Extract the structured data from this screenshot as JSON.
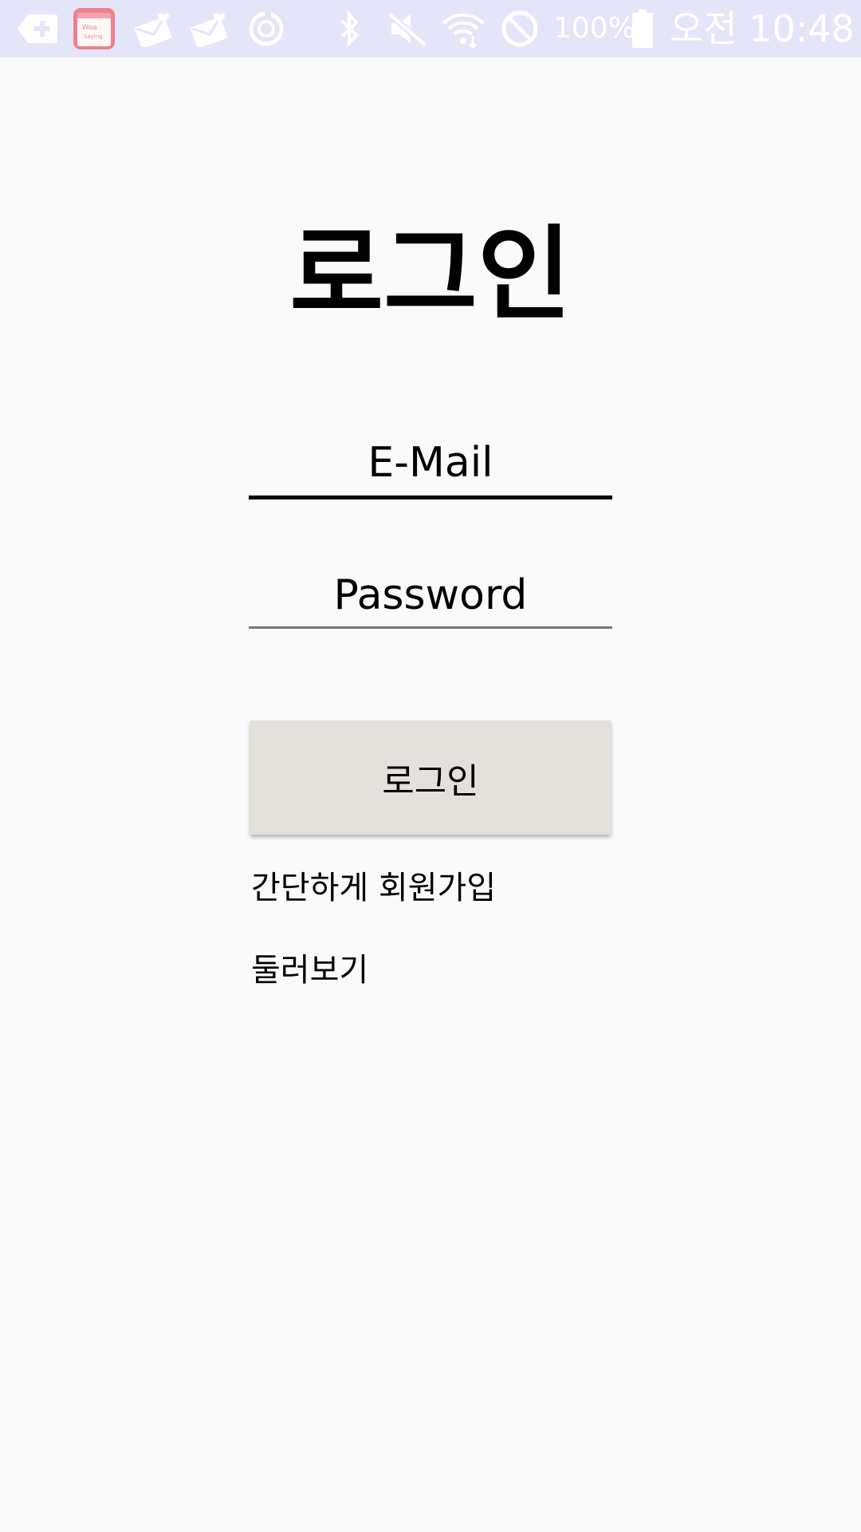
{
  "status_bar": {
    "battery_text": "100%",
    "time": "오전 10:48",
    "icons": [
      "add-tag-icon",
      "wise-saying-app-icon",
      "mail-heart-icon",
      "mail-heart-icon",
      "sync-icon",
      "bluetooth-icon",
      "mute-icon",
      "wifi-icon",
      "do-not-disturb-icon",
      "battery-icon"
    ],
    "app_icon_text": [
      "Wise",
      "Saying"
    ],
    "background_color": "#e5e5f9",
    "app_icon_color": "#f0808d"
  },
  "screen": {
    "title": "로그인",
    "email_value": "E-Mail",
    "password_value": "Password",
    "login_button_label": "로그인",
    "signup_link": "간단하게 회원가입",
    "browse_link": "둘러보기"
  },
  "colors": {
    "background": "#fafafa",
    "button_background": "#e4e1dc",
    "text": "#000000"
  }
}
